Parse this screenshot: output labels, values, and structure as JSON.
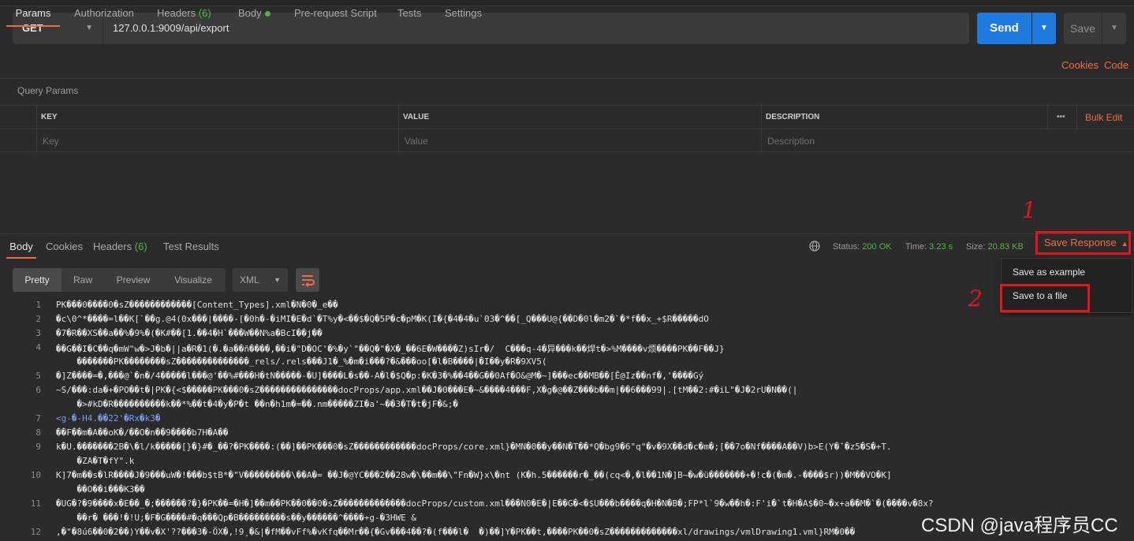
{
  "request": {
    "method": "GET",
    "url": "127.0.0.1:9009/api/export",
    "send_label": "Send",
    "save_label": "Save"
  },
  "request_tabs": {
    "params": "Params",
    "authorization": "Authorization",
    "headers": "Headers",
    "headers_count": "(6)",
    "body": "Body",
    "prerequest": "Pre-request Script",
    "tests": "Tests",
    "settings": "Settings",
    "cookies": "Cookies",
    "code": "Code"
  },
  "query_params": {
    "label": "Query Params",
    "col_key": "KEY",
    "col_value": "VALUE",
    "col_description": "DESCRIPTION",
    "more": "•••",
    "bulk_edit": "Bulk Edit",
    "ph_key": "Key",
    "ph_value": "Value",
    "ph_description": "Description"
  },
  "response": {
    "tabs": {
      "body": "Body",
      "cookies": "Cookies",
      "headers": "Headers",
      "headers_count": "(6)",
      "test_results": "Test Results"
    },
    "status_label": "Status:",
    "status_value": "200 OK",
    "time_label": "Time:",
    "time_value": "3.23 s",
    "size_label": "Size:",
    "size_value": "20.83 KB",
    "save_response": "Save Response",
    "menu": {
      "save_as_example": "Save as example",
      "save_to_file": "Save to a file"
    },
    "format": {
      "pretty": "Pretty",
      "raw": "Raw",
      "preview": "Preview",
      "visualize": "Visualize",
      "type": "XML"
    }
  },
  "annotations": {
    "one": "1",
    "two": "2"
  },
  "code_lines": [
    {
      "n": "1",
      "t": "PK���0����0�sZ������������[Content_Types].xml�N�0�_e��"
    },
    {
      "n": "2",
      "t": "�c\\0^*����=l��K[`��g.@4(0x���|����-[�0h�-�iMI�E�d`�T%y�<��$�Q�5P�c�pM�K(I�{�4�4�u`03�^��[_Q���U@{��D�0l�m2�`�*f��x_+$R�����dO"
    },
    {
      "n": "3",
      "t": "�7�R��XS��a��%�9%�(�K#��[1.��4�H`���W��N%a�BcI��j��"
    },
    {
      "n": "4",
      "t": "��G��I�C��q�mW\"w�>J�b�||a�R�1(�.�a��ñ����,��i�\"D�OC'�%�y`\"��Q�\"�X�_��6E�W����Z)sIr�/  C���q-4�异���k��焊t�>%M����v烦����PK��F��J}"
    },
    {
      "n": "",
      "t": "    �������PK��������sZ��������������_rels/.rels���J1�_%�m�i���?�&���oo[�l�B����|�I��y�R�9XV5("
    },
    {
      "n": "5",
      "t": "�]Z����=�,���@`�n�/4�����l���@'��%#���H�tN�����-�U]����L�s��-A�l�$Q�p:�K�3�%��4��G��0Af�O&@M�~]���ec��MB��[Ê@Iz��nf�,'����Gý"
    },
    {
      "n": "6",
      "t": "~S/���:da�+�PO��t�|PK�{<$�����PK���0�sZ���������������docProps/app.xml��J�0���E�~&����4���F,X�g�@��Z���b��m|��6���99|.[tM��2:#�iL\"�J�2rU�N��(|"
    },
    {
      "n": "",
      "t": "    �>#kD�R����������k��*%��t�4�y�P�t ��n�h1m�=��.nm�����ZI�a'~��3�T�t�jF�&;�"
    },
    {
      "n": "7",
      "t": "<g-�-H4.��22'�Rx�k3�",
      "c": "blue"
    },
    {
      "n": "8",
      "t": "��F��m�A��oK�/��O�n��9����b7H�A��"
    },
    {
      "n": "9",
      "t": "k�U.�������2B�\\�l/k�����[}�}#�_��?�PK����:(��]��PK���0�sZ������������docProps/core.xml}�MN�0��y��N�T��*Q�bg9�6\"q\"�v�9X��d�c�m�;[��7o�Nf����A��V)b>E(Y�ˇ�z5�S�+T."
    },
    {
      "n": "",
      "t": "    �ZA�T�fY\".k"
    },
    {
      "n": "10",
      "t": "K]7�m��s�lR����J�9���uW�!���b$tB*�\"V���������\\��A�= ��J�@YC���2��28w�\\��m��\\\"Fn�W}x\\�nt (K�h.5������r�_��(cq<�,�l��1N�]B~�w�ü�������+�!c�(�m�.-����$r))�M��VO�K]"
    },
    {
      "n": "",
      "t": "    ��O��i���K3��"
    },
    {
      "n": "11",
      "t": "�UG�?�9����x�E��_�;������?�}�PK��=�H�]��m��PK��0��0�sZ�������������docProps/custom.xml���N0�E�|E��G�<�$U���b����q�H�N�B�;FP*l`9�w��h�:F'i�`t�H�A$�0~�x+a��M�`�(����v�8x?"
    },
    {
      "n": "",
      "t": "    ��r� ���!�!U;�F�G����#�q���Qp�B���������s��y������^����+g-�3HWE &"
    },
    {
      "n": "12",
      "t": ",�\"�8ú6��0�2��)Y��v�X'??���3�-ÖX�,!9¸�&|�fM��vFf%�vKfq��Mr��{�Gv���4��?�(f���l�  �)��]Y�PK��t,����PK��0�sZ�������������xl/drawings/vmlDrawing1.vml}RM�0��"
    }
  ],
  "watermark": "CSDN @java程序员CC"
}
